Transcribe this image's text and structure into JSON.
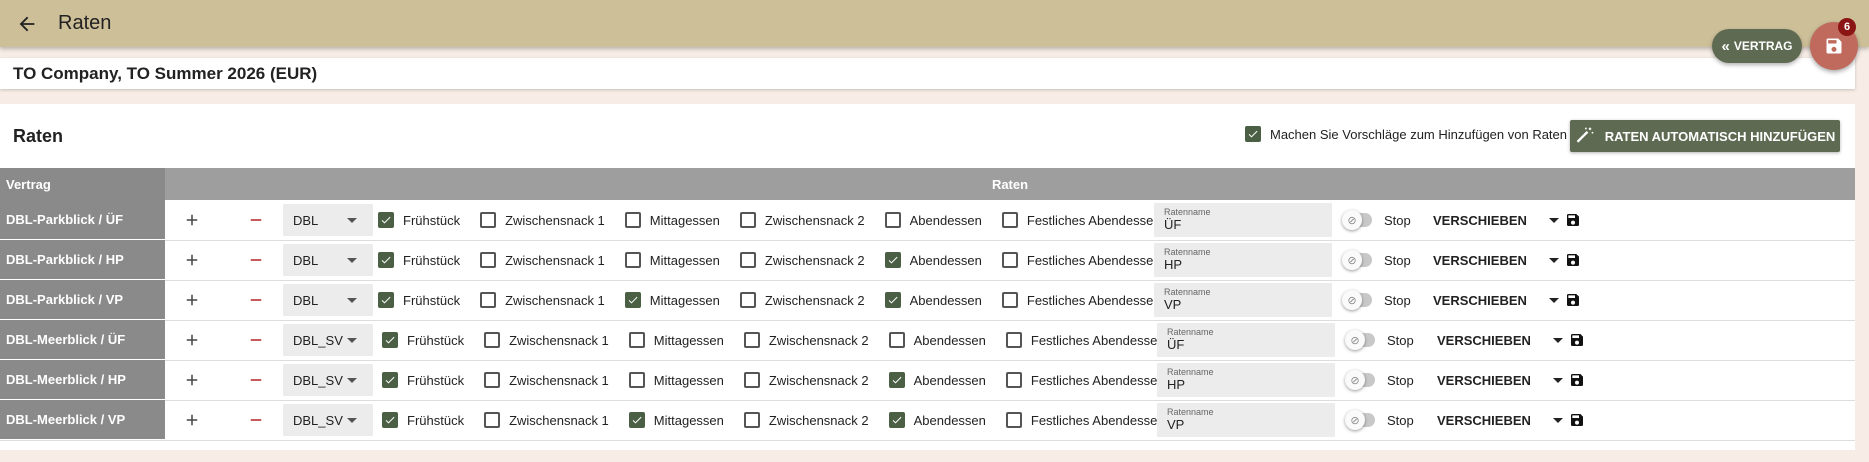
{
  "header": {
    "title": "Raten"
  },
  "company": {
    "label": "TO Company, TO Summer 2026 (EUR)"
  },
  "vertrag_button": {
    "label": "VERTRAG"
  },
  "save_fab": {
    "badge": "6"
  },
  "panel": {
    "title": "Raten",
    "suggest": {
      "label": "Machen Sie Vorschläge zum Hinzufügen von Raten",
      "checked": true
    },
    "auto_button": {
      "label": "RATEN AUTOMATISCH HINZUFÜGEN"
    }
  },
  "table": {
    "headers": {
      "vertrag": "Vertrag",
      "raten": "Raten"
    },
    "meal_labels": [
      "Frühstück",
      "Zwischensnack 1",
      "Mittagessen",
      "Zwischensnack 2",
      "Abendessen",
      "Festliches Abendessen"
    ],
    "ratename_label": "Ratenname",
    "stop_label": "Stop",
    "move_label": "VERSCHIEBEN",
    "rows": [
      {
        "vertrag": "DBL-Parkblick / ÜF",
        "room": "DBL",
        "meals": [
          true,
          false,
          false,
          false,
          false,
          false
        ],
        "ratename": "ÜF"
      },
      {
        "vertrag": "DBL-Parkblick / HP",
        "room": "DBL",
        "meals": [
          true,
          false,
          false,
          false,
          true,
          false
        ],
        "ratename": "HP"
      },
      {
        "vertrag": "DBL-Parkblick / VP",
        "room": "DBL",
        "meals": [
          true,
          false,
          true,
          false,
          true,
          false
        ],
        "ratename": "VP"
      },
      {
        "vertrag": "DBL-Meerblick / ÜF",
        "room": "DBL_SV",
        "meals": [
          true,
          false,
          false,
          false,
          false,
          false
        ],
        "ratename": "ÜF"
      },
      {
        "vertrag": "DBL-Meerblick / HP",
        "room": "DBL_SV",
        "meals": [
          true,
          false,
          false,
          false,
          true,
          false
        ],
        "ratename": "HP"
      },
      {
        "vertrag": "DBL-Meerblick / VP",
        "room": "DBL_SV",
        "meals": [
          true,
          false,
          true,
          false,
          true,
          false
        ],
        "ratename": "VP"
      }
    ]
  },
  "colors": {
    "topbar": "#cdbf98",
    "accent": "#5e6b52",
    "fab": "#bf6a5c",
    "minus": "#b22222"
  }
}
